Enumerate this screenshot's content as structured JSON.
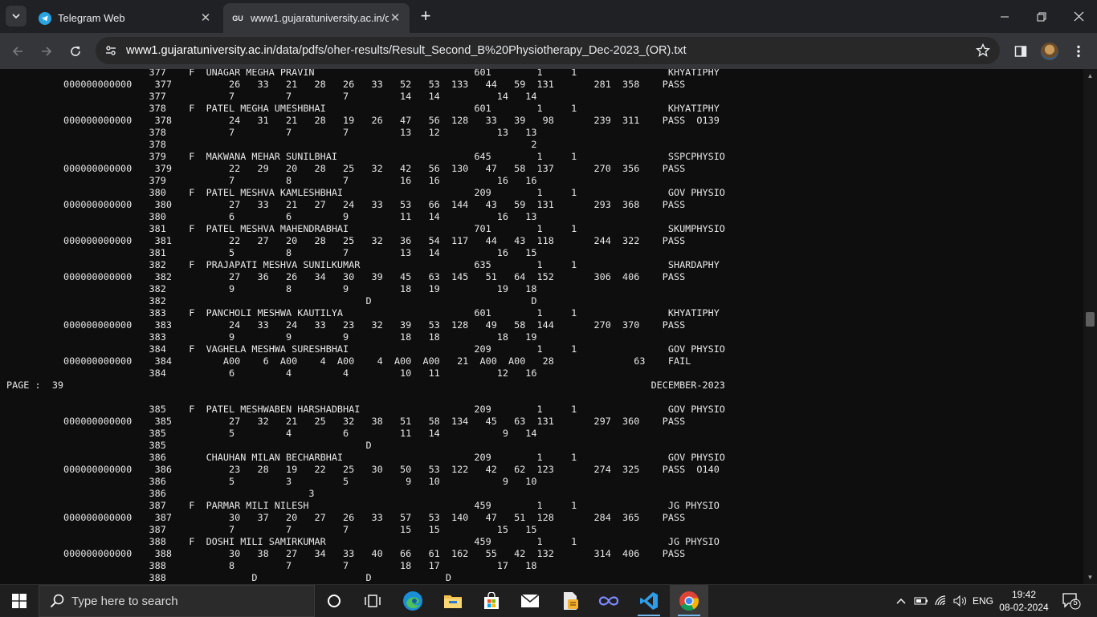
{
  "tabs": [
    {
      "title": "Telegram Web",
      "favicon": "telegram-icon",
      "active": false
    },
    {
      "title": "www1.gujaratuniversity.ac.in/da",
      "favicon_text": "GU",
      "active": true
    }
  ],
  "address_bar": {
    "host": "www1.gujaratuniversity.ac.in",
    "path": "/data/pdfs/oher-results/Result_Second_B%20Physiotherapy_Dec-2023_(OR).txt"
  },
  "document_lines": [
    "                         377    F  UNAGAR MEGHA PRAVIN                            601        1     1                KHYATIPHY",
    "          000000000000    377          26   33   21   28   26   33   52   53  133   44   59  131       281  358    PASS",
    "                         377           7         7         7         14   14          14   14",
    "                         378    F  PATEL MEGHA UMESHBHAI                          601        1     1                KHYATIPHY",
    "          000000000000    378          24   31   21   28   19   26   47   56  128   33   39   98       239  311    PASS  O139",
    "                         378           7         7         7         13   12          13   13",
    "                         378                                                                2",
    "                         379    F  MAKWANA MEHAR SUNILBHAI                        645        1     1                SSPCPHYSIO",
    "          000000000000    379          22   29   20   28   25   32   42   56  130   47   58  137       270  356    PASS",
    "                         379           7         8         7         16   16          16   16",
    "                         380    F  PATEL MESHVA KAMLESHBHAI                       209        1     1                GOV PHYSIO",
    "          000000000000    380          27   33   21   27   24   33   53   66  144   43   59  131       293  368    PASS",
    "                         380           6         6         9         11   14          16   13",
    "                         381    F  PATEL MESHVA MAHENDRABHAI                      701        1     1                SKUMPHYSIO",
    "          000000000000    381          22   27   20   28   25   32   36   54  117   44   43  118       244  322    PASS",
    "                         381           5         8         7         13   14          16   15",
    "                         382    F  PRAJAPATI MESHVA SUNILKUMAR                    635        1     1                SHARDAPHY",
    "          000000000000    382          27   36   26   34   30   39   45   63  145   51   64  152       306  406    PASS",
    "                         382           9         8         9         18   19          19   18",
    "                         382                                   D                            D",
    "                         383    F  PANCHOLI MESHWA KAUTILYA                       601        1     1                KHYATIPHY",
    "          000000000000    383          24   33   24   33   23   32   39   53  128   49   58  144       270  370    PASS",
    "                         383           9         9         9         18   18          18   19",
    "                         384    F  VAGHELA MESHWA SURESHBHAI                      209        1     1                GOV PHYSIO",
    "          000000000000    384         A00    6  A00    4  A00    4  A00  A00   21  A00  A00   28              63    FAIL",
    "                         384           6         4         4         10   11          12   16",
    "PAGE :  39                                                                                                       DECEMBER-2023",
    "",
    "                         385    F  PATEL MESHWABEN HARSHADBHAI                    209        1     1                GOV PHYSIO",
    "          000000000000    385          27   32   21   25   32   38   51   58  134   45   63  131       297  360    PASS",
    "                         385           5         4         6         11   14           9   14",
    "                         385                                   D",
    "                         386       CHAUHAN MILAN BECHARBHAI                       209        1     1                GOV PHYSIO",
    "          000000000000    386          23   28   19   22   25   30   50   53  122   42   62  123       274  325    PASS  O140",
    "                         386           5         3         5          9   10           9   10",
    "                         386                         3",
    "                         387    F  PARMAR MILI NILESH                             459        1     1                JG PHYSIO",
    "          000000000000    387          30   37   20   27   26   33   57   53  140   47   51  128       284  365    PASS",
    "                         387           7         7         7         15   15          15   15",
    "                         388    F  DOSHI MILI SAMIRKUMAR                          459        1     1                JG PHYSIO",
    "          000000000000    388          30   38   27   34   33   40   66   61  162   55   42  132       314  406    PASS",
    "                         388           8         7         7         18   17          17   18",
    "                         388               D                   D             D"
  ],
  "taskbar": {
    "search_placeholder": "Type here to search",
    "language": "ENG",
    "time": "19:42",
    "date": "08-02-2024",
    "notification_count": "5"
  }
}
